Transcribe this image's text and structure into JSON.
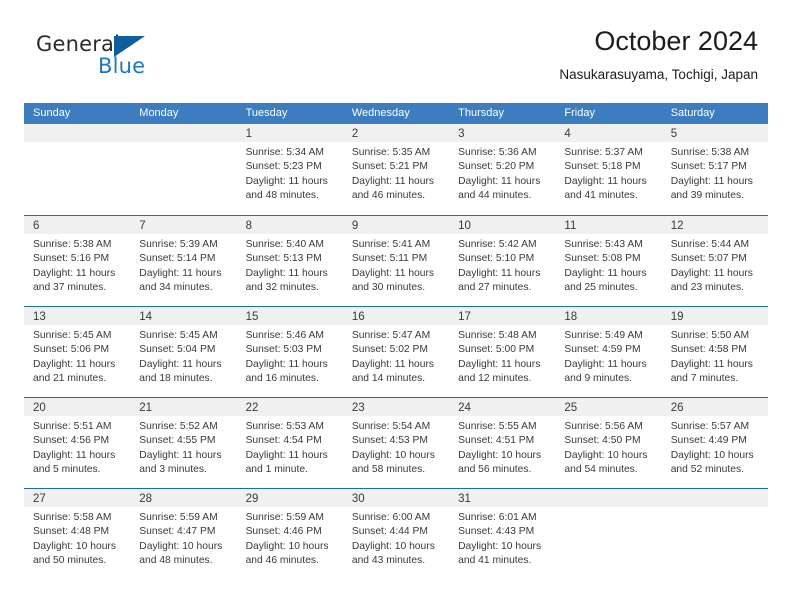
{
  "brand": {
    "word1": "General",
    "word2": "Blue",
    "triangle_icon": "triangle-logo-icon",
    "accent_color": "#0d5f9e",
    "blue_text_color": "#1b78c2"
  },
  "header": {
    "title": "October 2024",
    "subtitle": "Nasukarasuyama, Tochigi, Japan"
  },
  "theme": {
    "header_row_bg": "#3b7dbf",
    "row_divider": "#1f6bb0",
    "day_number_bg": "#f0f0f0",
    "text": "#3a3a3a"
  },
  "weekdays": [
    "Sunday",
    "Monday",
    "Tuesday",
    "Wednesday",
    "Thursday",
    "Friday",
    "Saturday"
  ],
  "weeks": [
    [
      {
        "day": "",
        "sunrise": "",
        "sunset": "",
        "daylight1": "",
        "daylight2": ""
      },
      {
        "day": "",
        "sunrise": "",
        "sunset": "",
        "daylight1": "",
        "daylight2": ""
      },
      {
        "day": "1",
        "sunrise": "Sunrise: 5:34 AM",
        "sunset": "Sunset: 5:23 PM",
        "daylight1": "Daylight: 11 hours",
        "daylight2": "and 48 minutes."
      },
      {
        "day": "2",
        "sunrise": "Sunrise: 5:35 AM",
        "sunset": "Sunset: 5:21 PM",
        "daylight1": "Daylight: 11 hours",
        "daylight2": "and 46 minutes."
      },
      {
        "day": "3",
        "sunrise": "Sunrise: 5:36 AM",
        "sunset": "Sunset: 5:20 PM",
        "daylight1": "Daylight: 11 hours",
        "daylight2": "and 44 minutes."
      },
      {
        "day": "4",
        "sunrise": "Sunrise: 5:37 AM",
        "sunset": "Sunset: 5:18 PM",
        "daylight1": "Daylight: 11 hours",
        "daylight2": "and 41 minutes."
      },
      {
        "day": "5",
        "sunrise": "Sunrise: 5:38 AM",
        "sunset": "Sunset: 5:17 PM",
        "daylight1": "Daylight: 11 hours",
        "daylight2": "and 39 minutes."
      }
    ],
    [
      {
        "day": "6",
        "sunrise": "Sunrise: 5:38 AM",
        "sunset": "Sunset: 5:16 PM",
        "daylight1": "Daylight: 11 hours",
        "daylight2": "and 37 minutes."
      },
      {
        "day": "7",
        "sunrise": "Sunrise: 5:39 AM",
        "sunset": "Sunset: 5:14 PM",
        "daylight1": "Daylight: 11 hours",
        "daylight2": "and 34 minutes."
      },
      {
        "day": "8",
        "sunrise": "Sunrise: 5:40 AM",
        "sunset": "Sunset: 5:13 PM",
        "daylight1": "Daylight: 11 hours",
        "daylight2": "and 32 minutes."
      },
      {
        "day": "9",
        "sunrise": "Sunrise: 5:41 AM",
        "sunset": "Sunset: 5:11 PM",
        "daylight1": "Daylight: 11 hours",
        "daylight2": "and 30 minutes."
      },
      {
        "day": "10",
        "sunrise": "Sunrise: 5:42 AM",
        "sunset": "Sunset: 5:10 PM",
        "daylight1": "Daylight: 11 hours",
        "daylight2": "and 27 minutes."
      },
      {
        "day": "11",
        "sunrise": "Sunrise: 5:43 AM",
        "sunset": "Sunset: 5:08 PM",
        "daylight1": "Daylight: 11 hours",
        "daylight2": "and 25 minutes."
      },
      {
        "day": "12",
        "sunrise": "Sunrise: 5:44 AM",
        "sunset": "Sunset: 5:07 PM",
        "daylight1": "Daylight: 11 hours",
        "daylight2": "and 23 minutes."
      }
    ],
    [
      {
        "day": "13",
        "sunrise": "Sunrise: 5:45 AM",
        "sunset": "Sunset: 5:06 PM",
        "daylight1": "Daylight: 11 hours",
        "daylight2": "and 21 minutes."
      },
      {
        "day": "14",
        "sunrise": "Sunrise: 5:45 AM",
        "sunset": "Sunset: 5:04 PM",
        "daylight1": "Daylight: 11 hours",
        "daylight2": "and 18 minutes."
      },
      {
        "day": "15",
        "sunrise": "Sunrise: 5:46 AM",
        "sunset": "Sunset: 5:03 PM",
        "daylight1": "Daylight: 11 hours",
        "daylight2": "and 16 minutes."
      },
      {
        "day": "16",
        "sunrise": "Sunrise: 5:47 AM",
        "sunset": "Sunset: 5:02 PM",
        "daylight1": "Daylight: 11 hours",
        "daylight2": "and 14 minutes."
      },
      {
        "day": "17",
        "sunrise": "Sunrise: 5:48 AM",
        "sunset": "Sunset: 5:00 PM",
        "daylight1": "Daylight: 11 hours",
        "daylight2": "and 12 minutes."
      },
      {
        "day": "18",
        "sunrise": "Sunrise: 5:49 AM",
        "sunset": "Sunset: 4:59 PM",
        "daylight1": "Daylight: 11 hours",
        "daylight2": "and 9 minutes."
      },
      {
        "day": "19",
        "sunrise": "Sunrise: 5:50 AM",
        "sunset": "Sunset: 4:58 PM",
        "daylight1": "Daylight: 11 hours",
        "daylight2": "and 7 minutes."
      }
    ],
    [
      {
        "day": "20",
        "sunrise": "Sunrise: 5:51 AM",
        "sunset": "Sunset: 4:56 PM",
        "daylight1": "Daylight: 11 hours",
        "daylight2": "and 5 minutes."
      },
      {
        "day": "21",
        "sunrise": "Sunrise: 5:52 AM",
        "sunset": "Sunset: 4:55 PM",
        "daylight1": "Daylight: 11 hours",
        "daylight2": "and 3 minutes."
      },
      {
        "day": "22",
        "sunrise": "Sunrise: 5:53 AM",
        "sunset": "Sunset: 4:54 PM",
        "daylight1": "Daylight: 11 hours",
        "daylight2": "and 1 minute."
      },
      {
        "day": "23",
        "sunrise": "Sunrise: 5:54 AM",
        "sunset": "Sunset: 4:53 PM",
        "daylight1": "Daylight: 10 hours",
        "daylight2": "and 58 minutes."
      },
      {
        "day": "24",
        "sunrise": "Sunrise: 5:55 AM",
        "sunset": "Sunset: 4:51 PM",
        "daylight1": "Daylight: 10 hours",
        "daylight2": "and 56 minutes."
      },
      {
        "day": "25",
        "sunrise": "Sunrise: 5:56 AM",
        "sunset": "Sunset: 4:50 PM",
        "daylight1": "Daylight: 10 hours",
        "daylight2": "and 54 minutes."
      },
      {
        "day": "26",
        "sunrise": "Sunrise: 5:57 AM",
        "sunset": "Sunset: 4:49 PM",
        "daylight1": "Daylight: 10 hours",
        "daylight2": "and 52 minutes."
      }
    ],
    [
      {
        "day": "27",
        "sunrise": "Sunrise: 5:58 AM",
        "sunset": "Sunset: 4:48 PM",
        "daylight1": "Daylight: 10 hours",
        "daylight2": "and 50 minutes."
      },
      {
        "day": "28",
        "sunrise": "Sunrise: 5:59 AM",
        "sunset": "Sunset: 4:47 PM",
        "daylight1": "Daylight: 10 hours",
        "daylight2": "and 48 minutes."
      },
      {
        "day": "29",
        "sunrise": "Sunrise: 5:59 AM",
        "sunset": "Sunset: 4:46 PM",
        "daylight1": "Daylight: 10 hours",
        "daylight2": "and 46 minutes."
      },
      {
        "day": "30",
        "sunrise": "Sunrise: 6:00 AM",
        "sunset": "Sunset: 4:44 PM",
        "daylight1": "Daylight: 10 hours",
        "daylight2": "and 43 minutes."
      },
      {
        "day": "31",
        "sunrise": "Sunrise: 6:01 AM",
        "sunset": "Sunset: 4:43 PM",
        "daylight1": "Daylight: 10 hours",
        "daylight2": "and 41 minutes."
      },
      {
        "day": "",
        "sunrise": "",
        "sunset": "",
        "daylight1": "",
        "daylight2": ""
      },
      {
        "day": "",
        "sunrise": "",
        "sunset": "",
        "daylight1": "",
        "daylight2": ""
      }
    ]
  ]
}
